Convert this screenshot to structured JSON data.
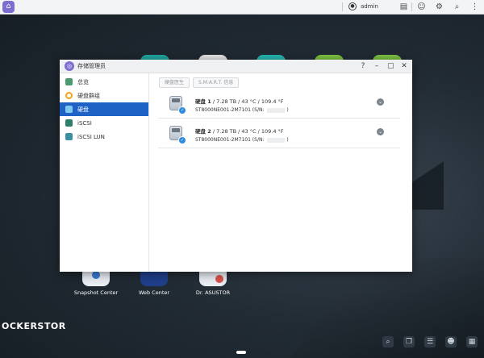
{
  "topbar": {
    "user_label": "admin"
  },
  "window": {
    "title": "存储管理员",
    "controls": {
      "help": "?",
      "minimize": "–",
      "maximize": "▢",
      "close": "✕"
    }
  },
  "sidebar": {
    "items": [
      {
        "label": "总览",
        "active": false,
        "color": "#4a9b6e"
      },
      {
        "label": "硬盘群组",
        "active": false,
        "color": "#f2a51a"
      },
      {
        "label": "硬盘",
        "active": true,
        "color": "#3b9ad9"
      },
      {
        "label": "iSCSI",
        "active": false,
        "color": "#2d7f6b"
      },
      {
        "label": "iSCSI LUN",
        "active": false,
        "color": "#3a8fa0"
      }
    ]
  },
  "tabs": [
    {
      "label": "硬盘医生"
    },
    {
      "label": "S.M.A.R.T. 信息"
    }
  ],
  "disks": [
    {
      "name": "硬盘 1",
      "details": " / 7.28 TB / 43 °C / 109.4 °F",
      "model_prefix": "ST8000NE001-2M7101 (S/N: ",
      "model_suffix": ")"
    },
    {
      "name": "硬盘 2",
      "details": " / 7.28 TB / 43 °C / 109.4 °F",
      "model_prefix": "ST8000NE001-2M7101 (S/N: ",
      "model_suffix": ")"
    }
  ],
  "desktop_icons": [
    {
      "label": "Snapshot Center"
    },
    {
      "label": "Web Center"
    },
    {
      "label": "Dr. ASUSTOR"
    }
  ],
  "brand": "OCKERSTOR"
}
